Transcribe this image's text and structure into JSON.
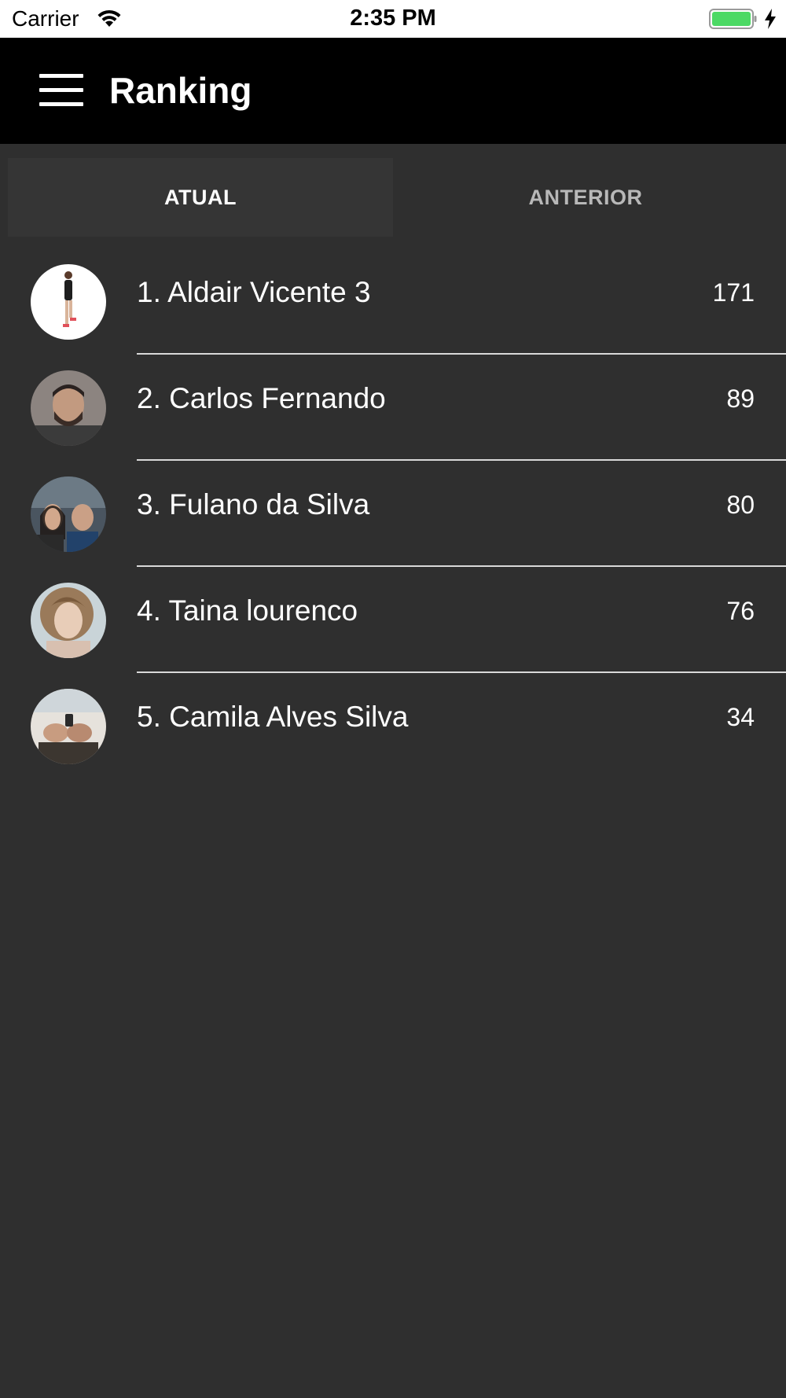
{
  "status_bar": {
    "carrier": "Carrier",
    "time": "2:35 PM",
    "battery_color": "#4cd964"
  },
  "header": {
    "title": "Ranking",
    "menu_icon": "hamburger-menu-icon"
  },
  "tabs": [
    {
      "label": "ATUAL",
      "selected": true
    },
    {
      "label": "ANTERIOR",
      "selected": false
    }
  ],
  "ranking": [
    {
      "label": "1. Aldair Vicente 3",
      "score": "171"
    },
    {
      "label": "2. Carlos Fernando",
      "score": "89"
    },
    {
      "label": "3. Fulano da Silva",
      "score": "80"
    },
    {
      "label": "4. Taina lourenco",
      "score": "76"
    },
    {
      "label": "5. Camila Alves Silva",
      "score": "34"
    }
  ]
}
